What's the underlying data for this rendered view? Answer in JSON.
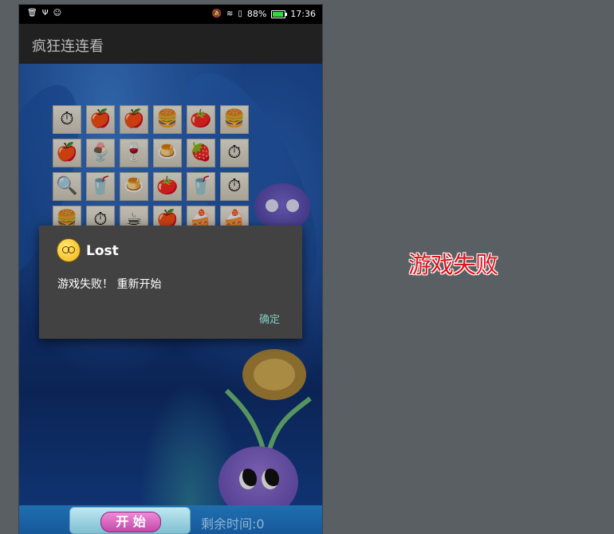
{
  "status_bar": {
    "left_icons": [
      "trash-icon",
      "usb-icon",
      "smiley-icon"
    ],
    "right_icons": [
      "mute-icon",
      "wifi-icon",
      "sim-icon"
    ],
    "battery_text": "88%",
    "battery_level": 0.88,
    "time": "17:36"
  },
  "app": {
    "title": "疯狂连连看"
  },
  "board": {
    "rows": [
      [
        "clock-plus-icon",
        "apple-icon",
        "apple-icon",
        "burger-icon",
        "tomato-icon",
        "burger-icon"
      ],
      [
        "apple-icon",
        "sundae-icon",
        "wine-icon",
        "pudding-icon",
        "strawberry-icon",
        "clock-plus-icon"
      ],
      [
        "magnifier-icon",
        "cup-icon",
        "pudding-icon",
        "tomato-icon",
        "cup-icon",
        "clock-plus-icon"
      ],
      [
        "burger-icon",
        "clock-plus-icon",
        "coffee-icon",
        "apple-icon",
        "cake-icon",
        "cake-icon"
      ]
    ],
    "glyphs": {
      "clock-plus-icon": "⏱",
      "apple-icon": "🍎",
      "burger-icon": "🍔",
      "tomato-icon": "🍅",
      "sundae-icon": "🍨",
      "wine-icon": "🍷",
      "pudding-icon": "🍮",
      "strawberry-icon": "🍓",
      "magnifier-icon": "🔍",
      "cup-icon": "🥤",
      "coffee-icon": "☕",
      "cake-icon": "🍰"
    }
  },
  "dialog": {
    "title": "Lost",
    "message": "游戏失败！ 重新开始",
    "ok_label": "确定"
  },
  "bottom": {
    "start_label": "开 始",
    "timer_text": "剩余时间:0"
  },
  "annotation": {
    "label": "游戏失败"
  }
}
